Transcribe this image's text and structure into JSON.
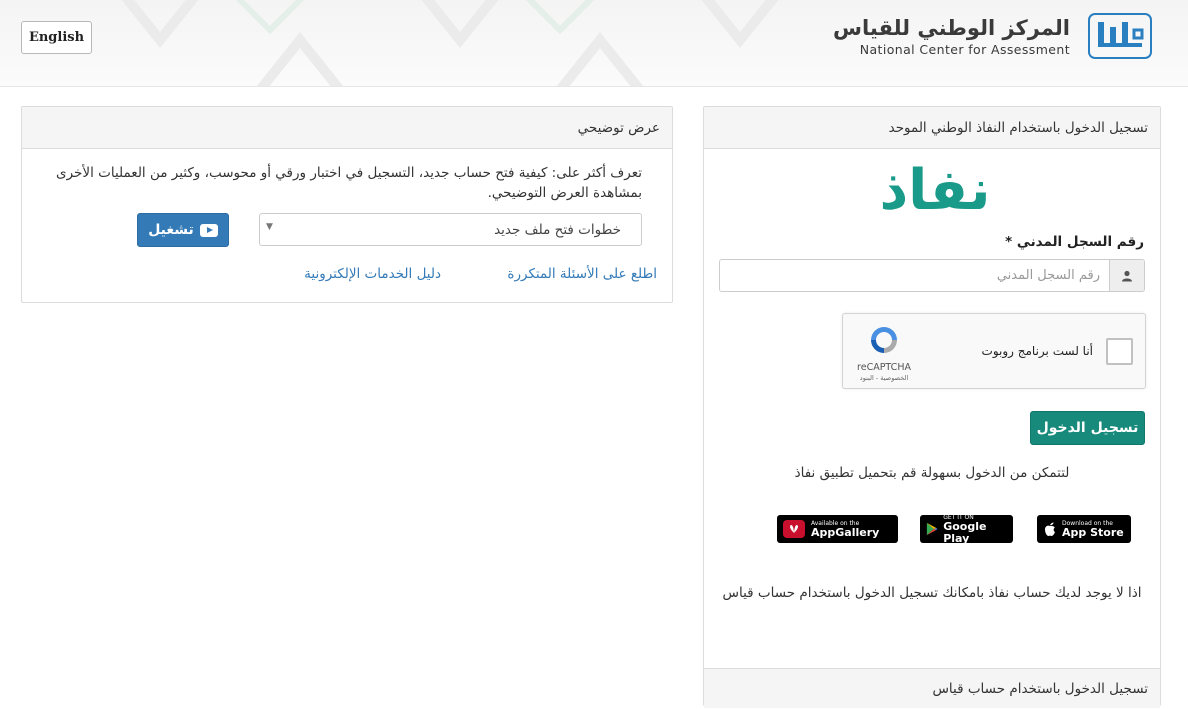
{
  "header": {
    "language_button": "English",
    "logo_title_ar": "المركز الوطني للقياس",
    "logo_title_en": "National Center for Assessment",
    "logo_mark_label": "QIYAS"
  },
  "demo_panel": {
    "title": "عرض توضيحي",
    "description": "تعرف أكثر على: كيفية فتح حساب جديد، التسجيل في اختبار ورقي أو محوسب، وكثير من العمليات الأخرى بمشاهدة العرض التوضيحي.",
    "select_value": "خطوات فتح ملف جديد",
    "play_button": "تشغيل",
    "faq_link": "اطلع على الأسئلة المتكررة",
    "services_link": "دليل الخدمات الإلكترونية"
  },
  "login_panel": {
    "title": "تسجيل الدخول باستخدام النفاذ الوطني الموحد",
    "brand_text": "نفاذ",
    "id_label": "رقم السجل المدني *",
    "id_placeholder": "رقم السجل المدني",
    "captcha_label": "أنا لست برنامج روبوت",
    "captcha_brand": "reCAPTCHA",
    "captcha_links": "الخصوصية - البنود",
    "login_button": "تسجيل الدخول",
    "app_hint": "لتتمكن من الدخول بسهولة قم بتحميل تطبيق نفاذ",
    "stores": {
      "huawei_small": "Available on the",
      "huawei_big": "AppGallery",
      "google_small": "GET IT ON",
      "google_big": "Google Play",
      "apple_small": "Download on the",
      "apple_big": "App Store"
    },
    "no_account_text": "اذا لا يوجد لديك حساب نفاذ بامكانك تسجيل الدخول باستخدام حساب قياس",
    "qiyas_login_title": "تسجيل الدخول باستخدام حساب قياس"
  },
  "colors": {
    "nafath_teal": "#1a9b8a",
    "login_button": "#178a7c",
    "play_button": "#337ab7",
    "link": "#337ab7"
  }
}
